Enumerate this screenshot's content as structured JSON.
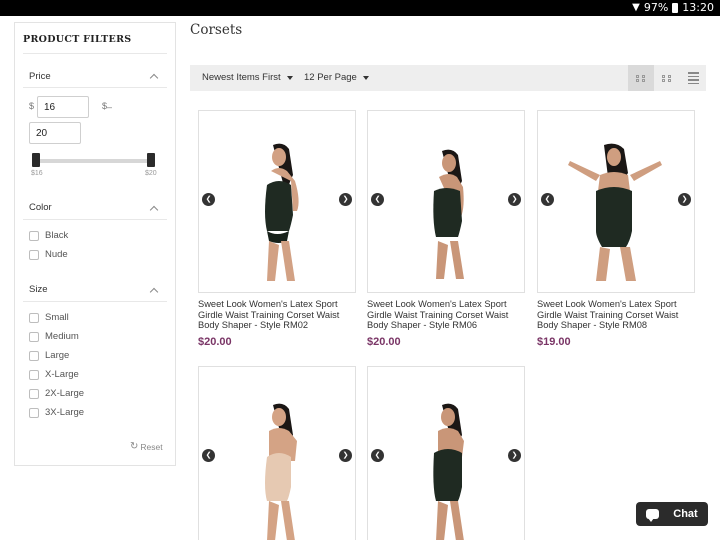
{
  "status_bar": {
    "battery": "97%",
    "time": "13:20"
  },
  "filters": {
    "title": "PRODUCT FILTERS",
    "price": {
      "label": "Price",
      "currency": "$",
      "dash": "–",
      "min_value": "16",
      "max_value": "20",
      "slider_min_label": "$16",
      "slider_max_label": "$20"
    },
    "color": {
      "label": "Color",
      "options": [
        "Black",
        "Nude"
      ]
    },
    "size": {
      "label": "Size",
      "options": [
        "Small",
        "Medium",
        "Large",
        "X-Large",
        "2X-Large",
        "3X-Large"
      ]
    },
    "reset_label": "Reset"
  },
  "page": {
    "title": "Corsets",
    "sort_label": "Newest Items First",
    "per_page_label": "12 Per Page",
    "view_modes": [
      "grid-large",
      "grid-small",
      "list"
    ],
    "active_view": "grid-large"
  },
  "products": [
    {
      "name": "Sweet Look Women's Latex Sport Girdle Waist Training Corset Waist Body Shaper - Style RM02",
      "price": "$20.00"
    },
    {
      "name": "Sweet Look Women's Latex Sport Girdle Waist Training Corset Waist Body Shaper - Style RM06",
      "price": "$20.00"
    },
    {
      "name": "Sweet Look Women's Latex Sport Girdle Waist Training Corset Waist Body Shaper - Style RM08",
      "price": "$19.00"
    },
    {
      "name": "",
      "price": ""
    },
    {
      "name": "",
      "price": ""
    }
  ],
  "chat": {
    "label": "Chat"
  },
  "colors": {
    "price": "#7a3566",
    "toolbar": "#eeeeee",
    "chat_bg": "#2b2b2b"
  }
}
